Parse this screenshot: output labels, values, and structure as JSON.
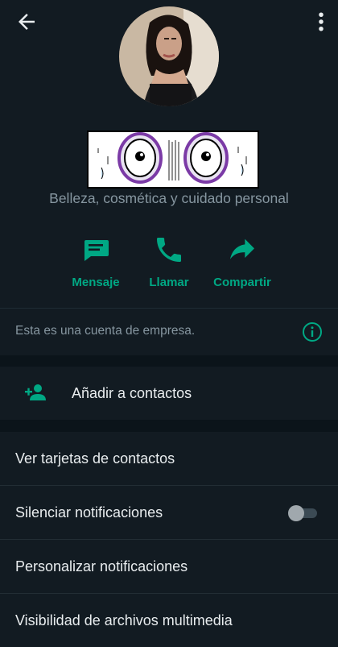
{
  "profile": {
    "category": "Belleza, cosmética y cuidado personal"
  },
  "actions": [
    {
      "label": "Mensaje",
      "icon": "message-icon"
    },
    {
      "label": "Llamar",
      "icon": "phone-icon"
    },
    {
      "label": "Compartir",
      "icon": "share-icon"
    }
  ],
  "business_notice": "Esta es una cuenta de empresa.",
  "add_contact": "Añadir a contactos",
  "list": [
    "Ver tarjetas de contactos",
    "Silenciar notificaciones",
    "Personalizar notificaciones",
    "Visibilidad de archivos multimedia"
  ],
  "colors": {
    "accent": "#00a884",
    "background": "#121b22",
    "text": "#e9edef",
    "muted": "#8696a0"
  }
}
